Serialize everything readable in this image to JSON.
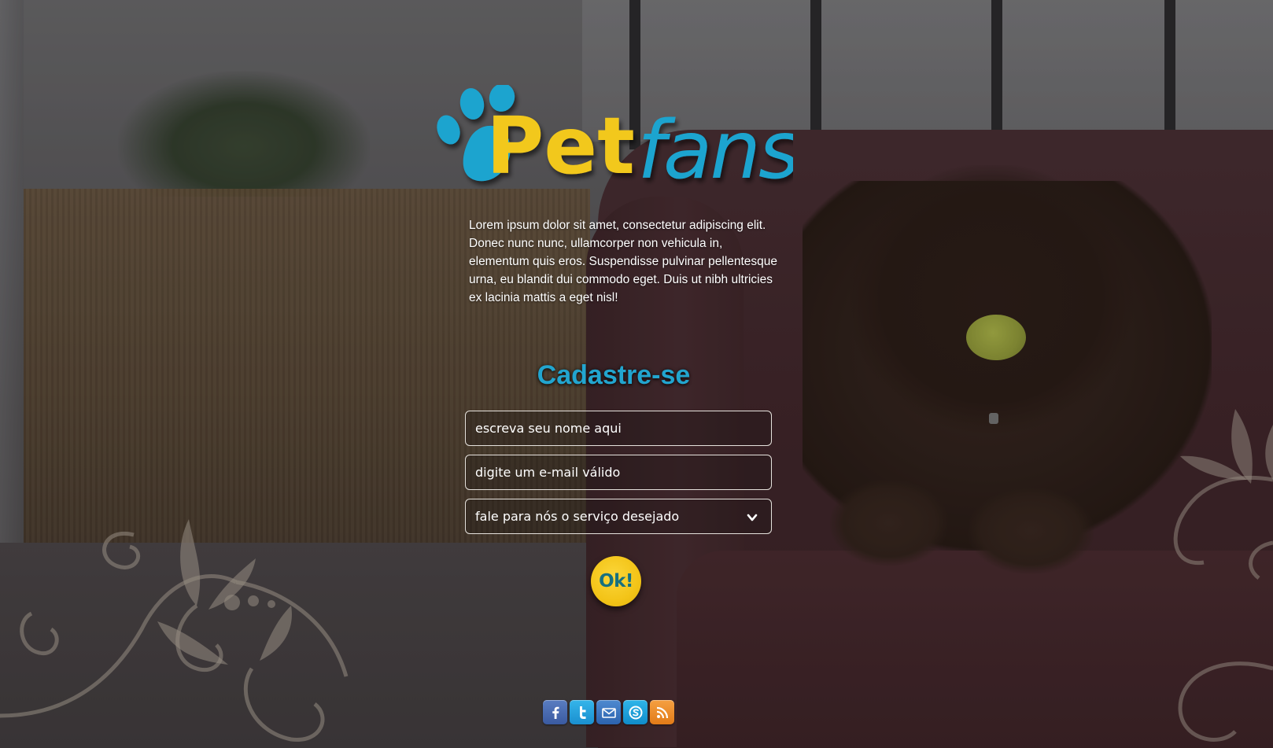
{
  "brand": {
    "word1": "Pet",
    "word2": "fans",
    "color_primary": "#f2c81b",
    "color_secondary": "#1ea4cf"
  },
  "intro": {
    "text": "Lorem ipsum dolor sit amet, consectetur adipiscing elit. Donec nunc nunc, ullamcorper non vehicula in, elementum quis eros. Suspendisse pulvinar pellentesque urna, eu blandit dui commodo eget. Duis ut nibh ultricies ex lacinia mattis a eget nisl!"
  },
  "form": {
    "title": "Cadastre-se",
    "name_placeholder": "escreva seu nome aqui",
    "email_placeholder": "digite um e-mail válido",
    "service_selected": "fale para nós o serviço desejado",
    "submit_label": "Ok!"
  },
  "social": [
    {
      "name": "facebook-icon",
      "color": "#3b5998"
    },
    {
      "name": "twitter-icon",
      "color": "#1da1f2"
    },
    {
      "name": "email-icon",
      "color": "#2c63ae"
    },
    {
      "name": "skype-icon",
      "color": "#00aff0"
    },
    {
      "name": "rss-icon",
      "color": "#f26522"
    }
  ]
}
